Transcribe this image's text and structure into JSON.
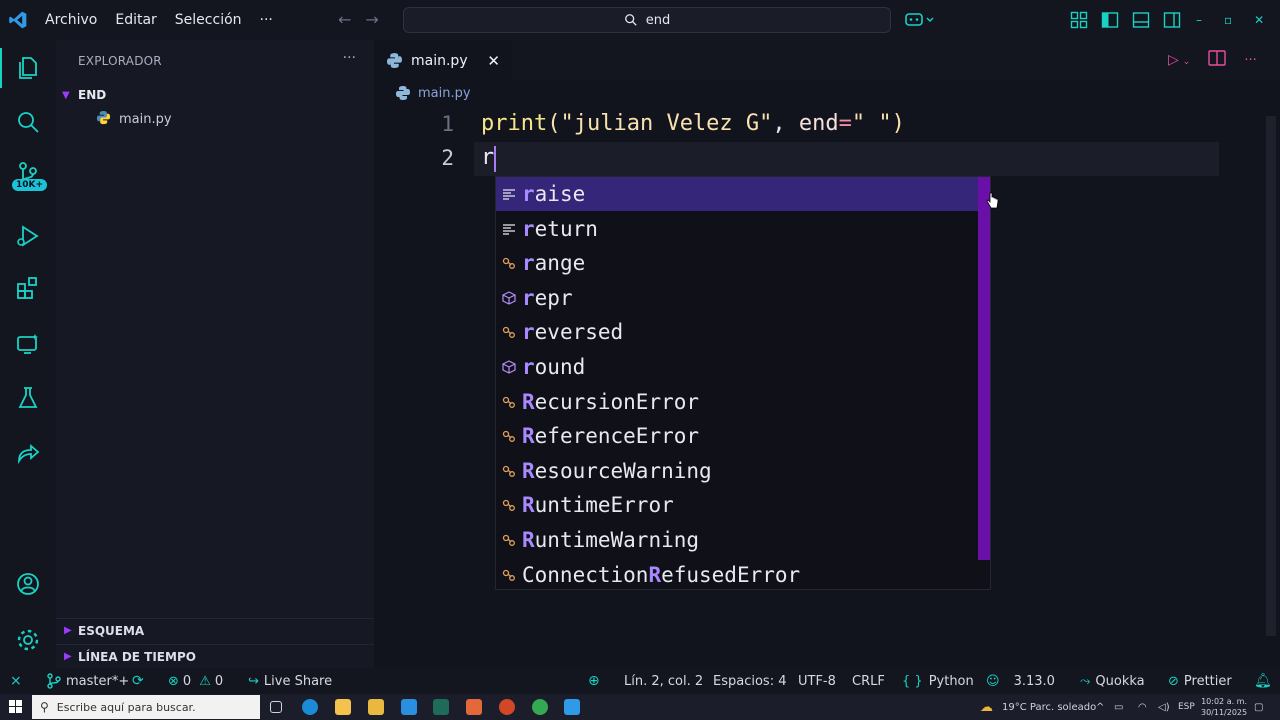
{
  "titlebar": {
    "menu": [
      "Archivo",
      "Editar",
      "Selección",
      "···"
    ],
    "search_text": "end"
  },
  "activity": {
    "badge": "10K+"
  },
  "sidebar": {
    "title": "EXPLORADOR",
    "folder": "END",
    "file": "main.py",
    "sections": [
      "ESQUEMA",
      "LÍNEA DE TIEMPO"
    ]
  },
  "editor": {
    "tab_label": "main.py",
    "breadcrumb": "main.py",
    "lines": [
      {
        "num": "1",
        "parts": [
          {
            "t": "print",
            "c": "#f7e58a"
          },
          {
            "t": "(",
            "c": "#f9e2af"
          },
          {
            "t": "\"julian Velez G\"",
            "c": "#f9e2af"
          },
          {
            "t": ", ",
            "c": "#e8e8f0"
          },
          {
            "t": "end",
            "c": "#f5e0dc"
          },
          {
            "t": "=",
            "c": "#f38ba8"
          },
          {
            "t": "\" \"",
            "c": "#f9e2af"
          },
          {
            "t": ")",
            "c": "#f9e2af"
          }
        ]
      },
      {
        "num": "2",
        "parts": [
          {
            "t": "r",
            "c": "#e8e8f0"
          }
        ]
      }
    ]
  },
  "suggestions": [
    {
      "kind": "keyword",
      "hl": "r",
      "rest": "aise",
      "selected": true
    },
    {
      "kind": "keyword",
      "hl": "r",
      "rest": "eturn"
    },
    {
      "kind": "class",
      "hl": "r",
      "rest": "ange"
    },
    {
      "kind": "function",
      "hl": "r",
      "rest": "epr"
    },
    {
      "kind": "class",
      "hl": "r",
      "rest": "eversed"
    },
    {
      "kind": "function",
      "hl": "r",
      "rest": "ound"
    },
    {
      "kind": "class",
      "hl": "R",
      "rest": "ecursionError"
    },
    {
      "kind": "class",
      "hl": "R",
      "rest": "eferenceError"
    },
    {
      "kind": "class",
      "hl": "R",
      "rest": "esourceWarning"
    },
    {
      "kind": "class",
      "hl": "R",
      "rest": "untimeError"
    },
    {
      "kind": "class",
      "hl": "R",
      "rest": "untimeWarning"
    },
    {
      "kind": "class",
      "pre": "Connection",
      "hl": "R",
      "rest": "efusedError"
    }
  ],
  "status": {
    "branch": "master*+",
    "errors": "0",
    "warnings": "0",
    "live_share": "Live Share",
    "position": "Lín. 2, col. 2",
    "spaces": "Espacios: 4",
    "encoding": "UTF-8",
    "eol": "CRLF",
    "language": "Python",
    "version": "3.13.0",
    "quokka": "Quokka",
    "prettier": "Prettier"
  },
  "taskbar": {
    "search_placeholder": "Escribe aquí para buscar.",
    "weather": "19°C  Parc. soleado",
    "lang": "ESP",
    "time": "10:02 a. m.",
    "date": "30/11/2025"
  },
  "colors": {
    "accent": "#19d2c4",
    "suggest_selected": "#36267a",
    "suggest_match": "#a989ff",
    "scroll_track": "#6a0fa8"
  }
}
